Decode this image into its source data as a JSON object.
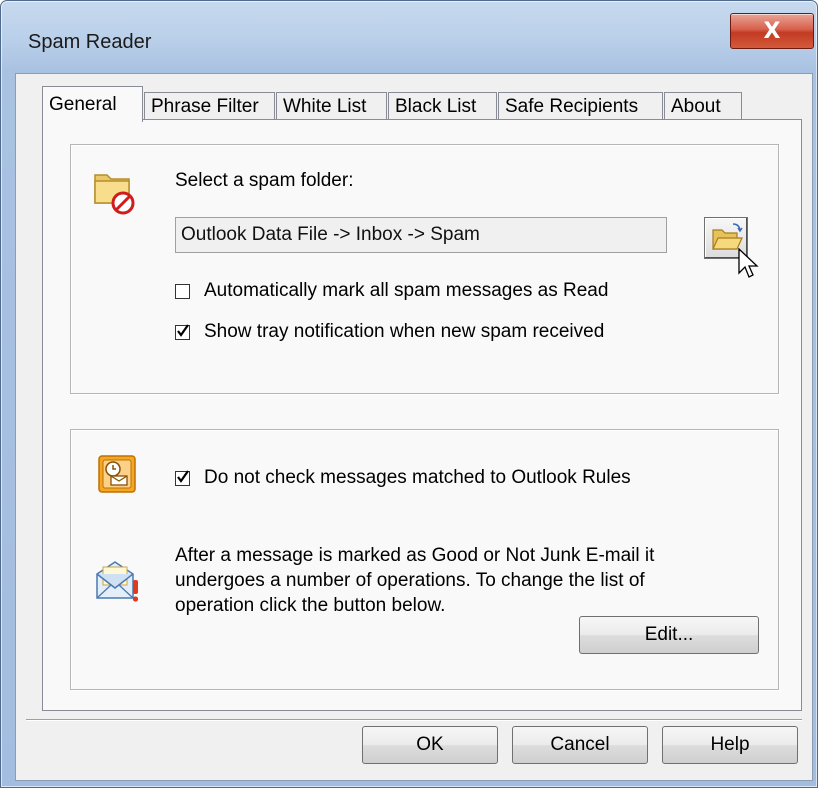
{
  "window": {
    "title": "Spam Reader",
    "close_glyph": "X"
  },
  "tabs": [
    {
      "label": "General",
      "active": true
    },
    {
      "label": "Phrase Filter",
      "active": false
    },
    {
      "label": "White List",
      "active": false
    },
    {
      "label": "Black List",
      "active": false
    },
    {
      "label": "Safe Recipients",
      "active": false
    },
    {
      "label": "About",
      "active": false
    }
  ],
  "spam_folder": {
    "label": "Select a spam folder:",
    "value": "Outlook Data File -> Inbox -> Spam",
    "icon": "spam-folder-icon",
    "browse_icon": "open-folder-icon",
    "mark_read": {
      "label": "Automatically mark all spam messages as Read",
      "checked": false
    },
    "tray_notification": {
      "label": "Show tray notification when new spam received",
      "checked": true
    }
  },
  "rules": {
    "icon": "outlook-rules-icon",
    "skip_rules": {
      "label": "Do not check messages matched to Outlook Rules",
      "checked": true
    },
    "info_icon": "envelope-alert-icon",
    "info_lines": [
      "After a message is marked as Good or Not Junk E-mail it",
      "undergoes a number of operations. To change the list of",
      "operation click the button below."
    ],
    "edit_label": "Edit..."
  },
  "footer": {
    "ok_label": "OK",
    "cancel_label": "Cancel",
    "help_label": "Help"
  },
  "colors": {
    "frame": "#a9c2e2",
    "close_button": "#c23a23",
    "dialog_background": "#f0f0f0"
  }
}
